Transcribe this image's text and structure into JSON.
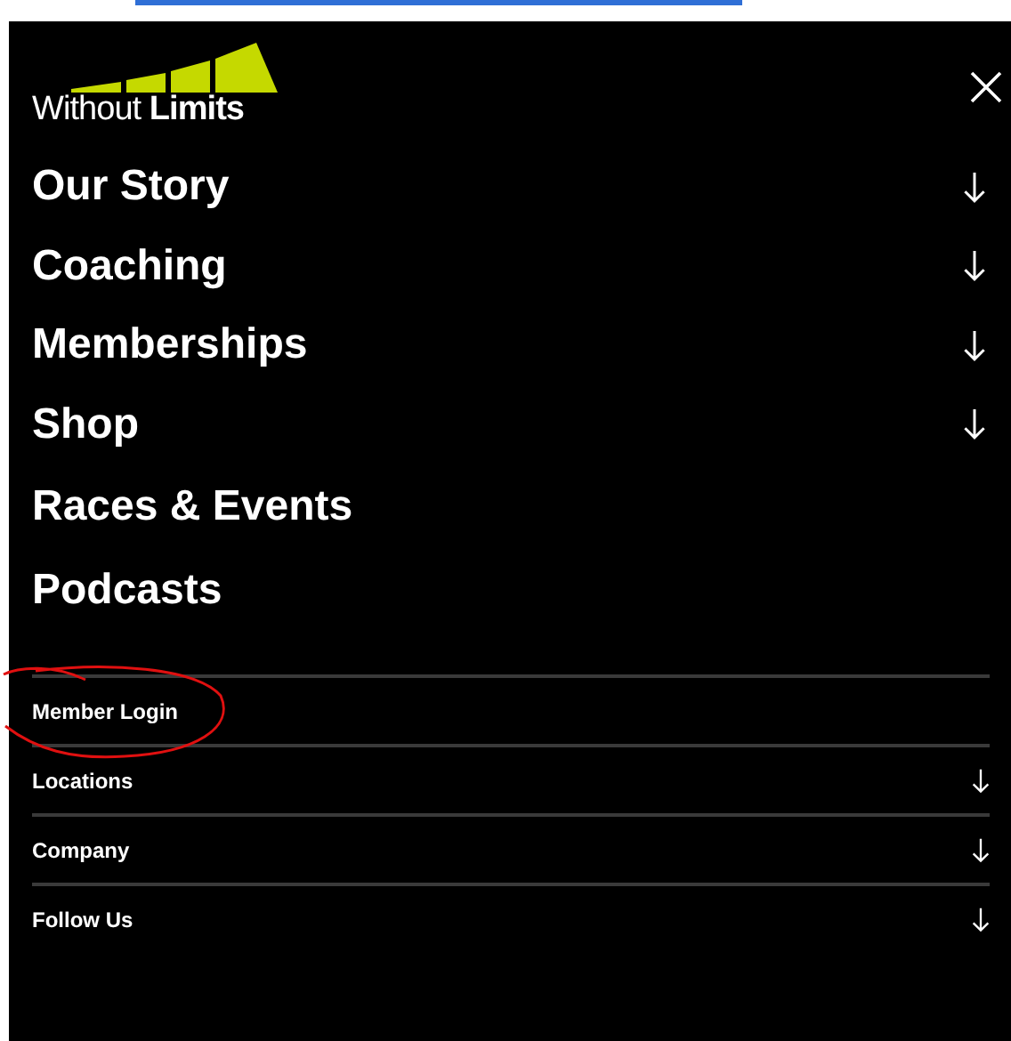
{
  "logo": {
    "text": "Without **Limits**"
  },
  "main_menu": [
    {
      "label": "Our Story",
      "has_submenu": true
    },
    {
      "label": "Coaching",
      "has_submenu": true
    },
    {
      "label": "Memberships",
      "has_submenu": true
    },
    {
      "label": "Shop",
      "has_submenu": true
    },
    {
      "label": "Races & Events",
      "has_submenu": false
    },
    {
      "label": "Podcasts",
      "has_submenu": false
    }
  ],
  "secondary_menu": [
    {
      "label": "Member Login",
      "has_submenu": false
    },
    {
      "label": "Locations",
      "has_submenu": true
    },
    {
      "label": "Company",
      "has_submenu": true
    },
    {
      "label": "Follow Us",
      "has_submenu": true
    }
  ]
}
